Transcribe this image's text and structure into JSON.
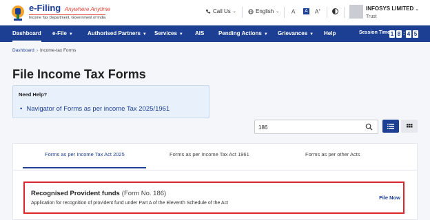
{
  "brand": {
    "title": "e-Filing",
    "tagline": "Anywhere Anytime",
    "subtitle": "Income Tax Department, Government of India"
  },
  "header": {
    "call_us": "Call Us",
    "language": "English",
    "font_decrease": "A",
    "font_normal": "A",
    "font_increase": "A",
    "user_name": "INFOSYS LIMITED",
    "user_role": "Trust"
  },
  "nav": {
    "items": [
      {
        "label": "Dashboard"
      },
      {
        "label": "e-File"
      },
      {
        "label": "Authorised Partners"
      },
      {
        "label": "Services"
      },
      {
        "label": "AIS"
      },
      {
        "label": "Pending Actions"
      },
      {
        "label": "Grievances"
      },
      {
        "label": "Help"
      }
    ],
    "session_label": "Session Time",
    "session_digits": [
      "1",
      "8",
      "4",
      "5"
    ]
  },
  "breadcrumb": {
    "home": "Dashboard",
    "current": "Income-tax Forms"
  },
  "page": {
    "title": "File Income Tax Forms"
  },
  "help": {
    "title": "Need Help?",
    "link": "Navigator of Forms as per income Tax 2025/1961"
  },
  "search": {
    "value": "186",
    "placeholder": ""
  },
  "tabs": [
    {
      "label": "Forms as per Income Tax Act 2025",
      "active": true
    },
    {
      "label": "Forms as per Income Tax Act 1961",
      "active": false
    },
    {
      "label": "Forms as per other Acts",
      "active": false
    }
  ],
  "result": {
    "title": "Recognised Provident funds",
    "form_no": "(Form No. 186)",
    "description": "Application for recognition of provident fund under Part A of the Eleventh Schedule of the Act",
    "action": "File Now"
  },
  "colors": {
    "primary": "#1c3f94",
    "highlight_border": "#d9262b",
    "tagline": "#e0433a"
  }
}
